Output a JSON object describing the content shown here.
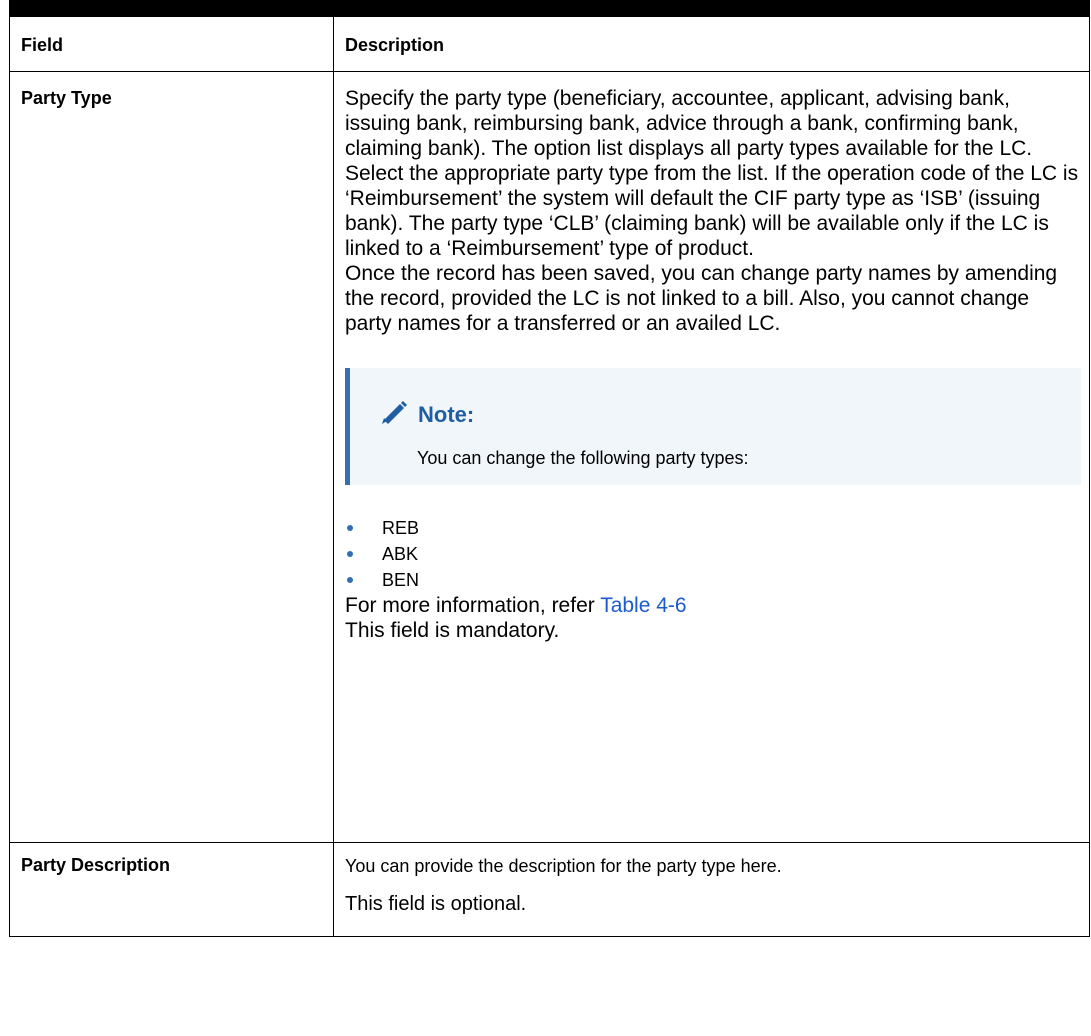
{
  "table": {
    "headers": {
      "field": "Field",
      "description": "Description"
    },
    "rows": [
      {
        "field": "Party Type",
        "paragraph1": "Specify the party type (beneficiary, accountee, applicant, advising bank, issuing bank, reimbursing bank, advice through a bank, confirming bank, claiming bank). The option list displays all party types available for the LC. Select the appropriate party type from the list. If the operation code of the LC is ‘Reimbursement’ the system will default the CIF party type as ‘ISB’ (issuing bank). The party type ‘CLB’ (claiming bank) will be available only if the LC is linked to a ‘Reimbursement’ type of product.",
        "paragraph2": "Once the record has been saved, you can change party names by amending the record, provided the LC is not linked to a bill. Also, you cannot change party names for a transferred or an availed LC.",
        "note": {
          "title": "Note:",
          "body": "You can change the following party types:",
          "icon": "pencil-icon"
        },
        "bullets": [
          "REB",
          "ABK",
          "BEN"
        ],
        "more_info_prefix": "For more information, refer ",
        "more_info_link": "Table 4-6",
        "mandatory": "This field is mandatory."
      },
      {
        "field": "Party Description",
        "line1": "You can provide the description for the party type here.",
        "line2": "This field is optional."
      }
    ]
  },
  "colors": {
    "accent": "#3a6ea8",
    "link": "#1a5bd1",
    "note_bg": "#f1f6fb"
  }
}
